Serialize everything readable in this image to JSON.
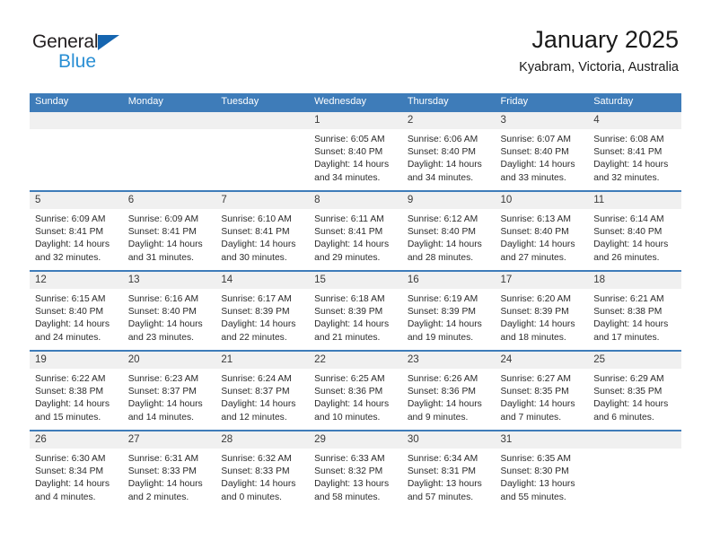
{
  "brand": {
    "line1": "General",
    "line2": "Blue",
    "triangle_color": "#1565b0",
    "blue_text_color": "#2a8fd4"
  },
  "header": {
    "title": "January 2025",
    "subtitle": "Kyabram, Victoria, Australia"
  },
  "theme": {
    "header_blue": "#3e7cb9",
    "daynum_gray": "#f0f0f0"
  },
  "labels": {
    "sunrise_prefix": "Sunrise:",
    "sunset_prefix": "Sunset:",
    "daylight_prefix": "Daylight:"
  },
  "weekdays": [
    "Sunday",
    "Monday",
    "Tuesday",
    "Wednesday",
    "Thursday",
    "Friday",
    "Saturday"
  ],
  "weeks": [
    [
      {
        "day": "",
        "empty": true
      },
      {
        "day": "",
        "empty": true
      },
      {
        "day": "",
        "empty": true
      },
      {
        "day": "1",
        "sunrise": "Sunrise: 6:05 AM",
        "sunset": "Sunset: 8:40 PM",
        "daylight1": "Daylight: 14 hours",
        "daylight2": "and 34 minutes."
      },
      {
        "day": "2",
        "sunrise": "Sunrise: 6:06 AM",
        "sunset": "Sunset: 8:40 PM",
        "daylight1": "Daylight: 14 hours",
        "daylight2": "and 34 minutes."
      },
      {
        "day": "3",
        "sunrise": "Sunrise: 6:07 AM",
        "sunset": "Sunset: 8:40 PM",
        "daylight1": "Daylight: 14 hours",
        "daylight2": "and 33 minutes."
      },
      {
        "day": "4",
        "sunrise": "Sunrise: 6:08 AM",
        "sunset": "Sunset: 8:41 PM",
        "daylight1": "Daylight: 14 hours",
        "daylight2": "and 32 minutes."
      }
    ],
    [
      {
        "day": "5",
        "sunrise": "Sunrise: 6:09 AM",
        "sunset": "Sunset: 8:41 PM",
        "daylight1": "Daylight: 14 hours",
        "daylight2": "and 32 minutes."
      },
      {
        "day": "6",
        "sunrise": "Sunrise: 6:09 AM",
        "sunset": "Sunset: 8:41 PM",
        "daylight1": "Daylight: 14 hours",
        "daylight2": "and 31 minutes."
      },
      {
        "day": "7",
        "sunrise": "Sunrise: 6:10 AM",
        "sunset": "Sunset: 8:41 PM",
        "daylight1": "Daylight: 14 hours",
        "daylight2": "and 30 minutes."
      },
      {
        "day": "8",
        "sunrise": "Sunrise: 6:11 AM",
        "sunset": "Sunset: 8:41 PM",
        "daylight1": "Daylight: 14 hours",
        "daylight2": "and 29 minutes."
      },
      {
        "day": "9",
        "sunrise": "Sunrise: 6:12 AM",
        "sunset": "Sunset: 8:40 PM",
        "daylight1": "Daylight: 14 hours",
        "daylight2": "and 28 minutes."
      },
      {
        "day": "10",
        "sunrise": "Sunrise: 6:13 AM",
        "sunset": "Sunset: 8:40 PM",
        "daylight1": "Daylight: 14 hours",
        "daylight2": "and 27 minutes."
      },
      {
        "day": "11",
        "sunrise": "Sunrise: 6:14 AM",
        "sunset": "Sunset: 8:40 PM",
        "daylight1": "Daylight: 14 hours",
        "daylight2": "and 26 minutes."
      }
    ],
    [
      {
        "day": "12",
        "sunrise": "Sunrise: 6:15 AM",
        "sunset": "Sunset: 8:40 PM",
        "daylight1": "Daylight: 14 hours",
        "daylight2": "and 24 minutes."
      },
      {
        "day": "13",
        "sunrise": "Sunrise: 6:16 AM",
        "sunset": "Sunset: 8:40 PM",
        "daylight1": "Daylight: 14 hours",
        "daylight2": "and 23 minutes."
      },
      {
        "day": "14",
        "sunrise": "Sunrise: 6:17 AM",
        "sunset": "Sunset: 8:39 PM",
        "daylight1": "Daylight: 14 hours",
        "daylight2": "and 22 minutes."
      },
      {
        "day": "15",
        "sunrise": "Sunrise: 6:18 AM",
        "sunset": "Sunset: 8:39 PM",
        "daylight1": "Daylight: 14 hours",
        "daylight2": "and 21 minutes."
      },
      {
        "day": "16",
        "sunrise": "Sunrise: 6:19 AM",
        "sunset": "Sunset: 8:39 PM",
        "daylight1": "Daylight: 14 hours",
        "daylight2": "and 19 minutes."
      },
      {
        "day": "17",
        "sunrise": "Sunrise: 6:20 AM",
        "sunset": "Sunset: 8:39 PM",
        "daylight1": "Daylight: 14 hours",
        "daylight2": "and 18 minutes."
      },
      {
        "day": "18",
        "sunrise": "Sunrise: 6:21 AM",
        "sunset": "Sunset: 8:38 PM",
        "daylight1": "Daylight: 14 hours",
        "daylight2": "and 17 minutes."
      }
    ],
    [
      {
        "day": "19",
        "sunrise": "Sunrise: 6:22 AM",
        "sunset": "Sunset: 8:38 PM",
        "daylight1": "Daylight: 14 hours",
        "daylight2": "and 15 minutes."
      },
      {
        "day": "20",
        "sunrise": "Sunrise: 6:23 AM",
        "sunset": "Sunset: 8:37 PM",
        "daylight1": "Daylight: 14 hours",
        "daylight2": "and 14 minutes."
      },
      {
        "day": "21",
        "sunrise": "Sunrise: 6:24 AM",
        "sunset": "Sunset: 8:37 PM",
        "daylight1": "Daylight: 14 hours",
        "daylight2": "and 12 minutes."
      },
      {
        "day": "22",
        "sunrise": "Sunrise: 6:25 AM",
        "sunset": "Sunset: 8:36 PM",
        "daylight1": "Daylight: 14 hours",
        "daylight2": "and 10 minutes."
      },
      {
        "day": "23",
        "sunrise": "Sunrise: 6:26 AM",
        "sunset": "Sunset: 8:36 PM",
        "daylight1": "Daylight: 14 hours",
        "daylight2": "and 9 minutes."
      },
      {
        "day": "24",
        "sunrise": "Sunrise: 6:27 AM",
        "sunset": "Sunset: 8:35 PM",
        "daylight1": "Daylight: 14 hours",
        "daylight2": "and 7 minutes."
      },
      {
        "day": "25",
        "sunrise": "Sunrise: 6:29 AM",
        "sunset": "Sunset: 8:35 PM",
        "daylight1": "Daylight: 14 hours",
        "daylight2": "and 6 minutes."
      }
    ],
    [
      {
        "day": "26",
        "sunrise": "Sunrise: 6:30 AM",
        "sunset": "Sunset: 8:34 PM",
        "daylight1": "Daylight: 14 hours",
        "daylight2": "and 4 minutes."
      },
      {
        "day": "27",
        "sunrise": "Sunrise: 6:31 AM",
        "sunset": "Sunset: 8:33 PM",
        "daylight1": "Daylight: 14 hours",
        "daylight2": "and 2 minutes."
      },
      {
        "day": "28",
        "sunrise": "Sunrise: 6:32 AM",
        "sunset": "Sunset: 8:33 PM",
        "daylight1": "Daylight: 14 hours",
        "daylight2": "and 0 minutes."
      },
      {
        "day": "29",
        "sunrise": "Sunrise: 6:33 AM",
        "sunset": "Sunset: 8:32 PM",
        "daylight1": "Daylight: 13 hours",
        "daylight2": "and 58 minutes."
      },
      {
        "day": "30",
        "sunrise": "Sunrise: 6:34 AM",
        "sunset": "Sunset: 8:31 PM",
        "daylight1": "Daylight: 13 hours",
        "daylight2": "and 57 minutes."
      },
      {
        "day": "31",
        "sunrise": "Sunrise: 6:35 AM",
        "sunset": "Sunset: 8:30 PM",
        "daylight1": "Daylight: 13 hours",
        "daylight2": "and 55 minutes."
      },
      {
        "day": "",
        "empty": true
      }
    ]
  ]
}
